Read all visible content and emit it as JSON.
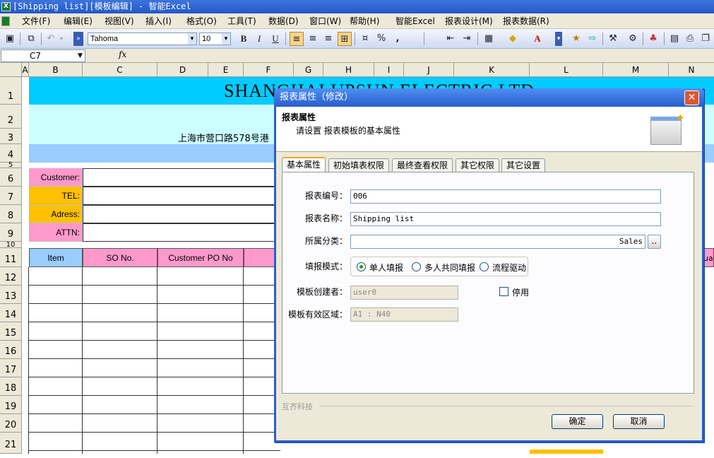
{
  "titlebar": {
    "title": "[Shipping list][模板编辑] - 智能Excel",
    "app_icon_glyph": "X"
  },
  "menu": [
    "文件(F)",
    "编辑(E)",
    "视图(V)",
    "插入(I)",
    "格式(O)",
    "工具(T)",
    "数据(D)",
    "窗口(W)",
    "帮助(H)",
    "智能Excel",
    "报表设计(M)",
    "报表数据(R)"
  ],
  "toolbar": {
    "font_name": "Tahoma",
    "font_size": "10",
    "bold": "B",
    "italic": "I",
    "underline": "U",
    "percent": "%",
    "comma": ","
  },
  "formula_bar": {
    "cell_ref": "C7",
    "fx": "fx"
  },
  "columns": [
    "A",
    "B",
    "C",
    "D",
    "E",
    "F",
    "G",
    "H",
    "I",
    "J",
    "K",
    "L",
    "M",
    "N"
  ],
  "rows": [
    "1",
    "2",
    "3",
    "4",
    "5",
    "6",
    "7",
    "8",
    "9",
    "10",
    "11",
    "12",
    "13",
    "14",
    "15",
    "16",
    "17",
    "18",
    "19",
    "20",
    "21"
  ],
  "sheet": {
    "company_title": "SHANGHAI UPSUN ELECTRIC LTD",
    "address": "上海市营口路578号港",
    "customer_label": "Customer:",
    "tel_label": "TEL:",
    "address_label": "Adress:",
    "attn_label": "ATTN:",
    "header_item": "Item",
    "header_so": "SO No.",
    "header_po": "Customer PO No",
    "header_n_fragment": "uar"
  },
  "dialog": {
    "title": "报表属性（修改）",
    "close": "✕",
    "header_title": "报表属性",
    "header_desc": "请设置 报表模板的基本属性",
    "tabs": [
      "基本属性",
      "初始填表权限",
      "最终查看权限",
      "其它权限",
      "其它设置"
    ],
    "fields": {
      "report_no_label": "报表编号：",
      "report_no_value": "006",
      "report_name_label": "报表名称：",
      "report_name_value": "Shipping list",
      "category_label": "所属分类：",
      "category_value": "Sales",
      "category_browse": "..",
      "fill_mode_label": "填报模式：",
      "fill_mode_options": [
        "单人填报",
        "多人共同填报",
        "流程驱动"
      ],
      "creator_label": "模板创建者：",
      "creator_value": "user0",
      "disabled_label": "停用",
      "range_label": "模板有效区域：",
      "range_value": "A1 : N40"
    },
    "footer_brand": "互齐科技",
    "ok": "确定",
    "cancel": "取消"
  }
}
